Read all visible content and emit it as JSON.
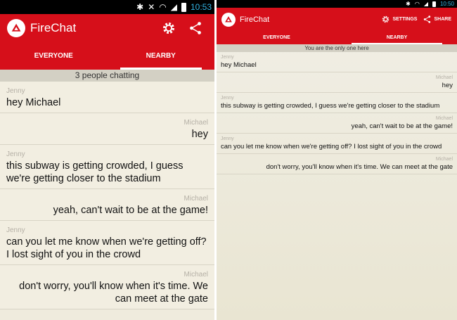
{
  "app": {
    "title": "FireChat",
    "brand_color": "#d60f1a"
  },
  "left": {
    "status": {
      "time": "10:53",
      "icons": [
        "bluetooth-icon",
        "no-sound-icon",
        "wifi-icon",
        "signal-icon",
        "battery-icon"
      ]
    },
    "actions": {
      "settings_icon": "gear-icon",
      "share_icon": "share-icon"
    },
    "tabs": [
      {
        "label": "EVERYONE"
      },
      {
        "label": "NEARBY",
        "active": true
      }
    ],
    "banner": "3 people chatting",
    "messages": [
      {
        "sender": "Jenny",
        "text": "hey Michael",
        "align": "left"
      },
      {
        "sender": "Michael",
        "text": "hey",
        "align": "right"
      },
      {
        "sender": "Jenny",
        "text": "this subway is getting crowded, I guess we're getting closer to the stadium",
        "align": "left"
      },
      {
        "sender": "Michael",
        "text": "yeah, can't wait to be at the game!",
        "align": "right"
      },
      {
        "sender": "Jenny",
        "text": "can you let me know when we're getting off? I lost sight of you in the crowd",
        "align": "left"
      },
      {
        "sender": "Michael",
        "text": "don't worry, you'll know when it's time. We can meet at the gate",
        "align": "right"
      }
    ]
  },
  "right": {
    "status": {
      "time": "10:50",
      "icons": [
        "bluetooth-icon",
        "wifi-icon",
        "signal-icon",
        "battery-icon"
      ]
    },
    "actions": {
      "settings_label": "SETTINGS",
      "share_label": "SHARE",
      "settings_icon": "gear-icon",
      "share_icon": "share-icon"
    },
    "tabs": [
      {
        "label": "EVERYONE"
      },
      {
        "label": "NEARBY",
        "active": true
      }
    ],
    "banner": "You are the only one here",
    "messages": [
      {
        "sender": "Jenny",
        "text": "hey Michael",
        "align": "left"
      },
      {
        "sender": "Michael",
        "text": "hey",
        "align": "right"
      },
      {
        "sender": "Jenny",
        "text": "this subway is getting crowded, I guess we're getting closer to the stadium",
        "align": "left"
      },
      {
        "sender": "Michael",
        "text": "yeah, can't wait to be at the game!",
        "align": "right"
      },
      {
        "sender": "Jenny",
        "text": "can you let me know when we're getting off? I lost sight of you in the crowd",
        "align": "left"
      },
      {
        "sender": "Michael",
        "text": "don't worry, you'll know when it's time. We can meet at the gate",
        "align": "right"
      }
    ]
  }
}
